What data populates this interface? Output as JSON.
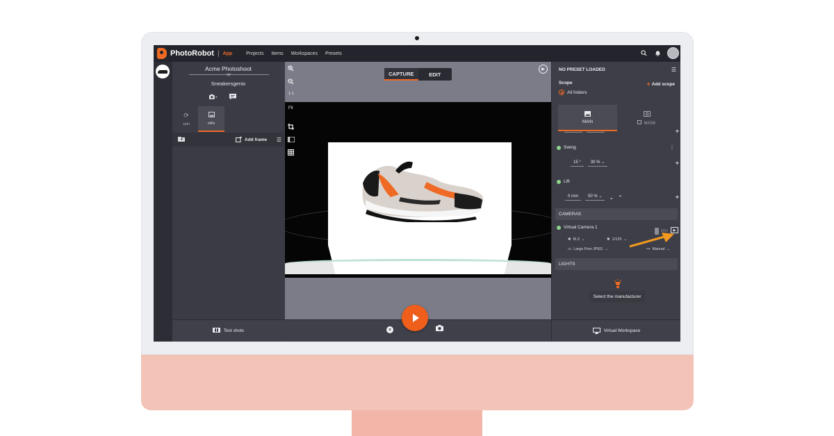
{
  "app": {
    "brand": "PhotoRobot",
    "separator": "|",
    "app_label": "App",
    "nav": [
      "Projects",
      "Items",
      "Workspaces",
      "Presets"
    ],
    "accent_color": "#ef6a24"
  },
  "topbar_icons": [
    "search-icon",
    "bell-icon",
    "avatar"
  ],
  "left_panel": {
    "project_name": "Acme Photoshoot",
    "item_name": "Sneakersgenix",
    "tabs": [
      {
        "label": "spin",
        "icon": "spin-icon",
        "active": false
      },
      {
        "label": "stills",
        "icon": "stills-icon",
        "active": true
      }
    ],
    "add_frame_label": "Add frame",
    "test_shots_label": "Test shots"
  },
  "viewer": {
    "modes": [
      {
        "label": "CAPTURE",
        "active": true
      },
      {
        "label": "EDIT",
        "active": false
      }
    ],
    "zoom_ratio_label": "1:1",
    "fit_label": "Fit"
  },
  "right_panel": {
    "preset_status": "NO PRESET LOADED",
    "scope_label": "Scope",
    "add_scope_label": "Add scope",
    "scope_value": "All folders",
    "tabs": [
      {
        "label": "MAIN",
        "active": true
      },
      {
        "label": "MASK",
        "active": false
      }
    ],
    "swing": {
      "label": "Swing",
      "angle": "15 °",
      "speed": "30 %"
    },
    "lift": {
      "label": "Lift",
      "position": "0 mm",
      "speed": "50 %"
    },
    "cameras_section": "CAMERAS",
    "camera": {
      "name": "Virtual Camera 1",
      "battery": "80%",
      "aperture": "f6.3",
      "shutter": "1/125",
      "format": "Large Fine JPEG",
      "mode": "Manual"
    },
    "lights_section": "LIGHTS",
    "manufacturer_button": "Select the manufacturer",
    "virtual_workspace_label": "Virtual Workspace"
  }
}
